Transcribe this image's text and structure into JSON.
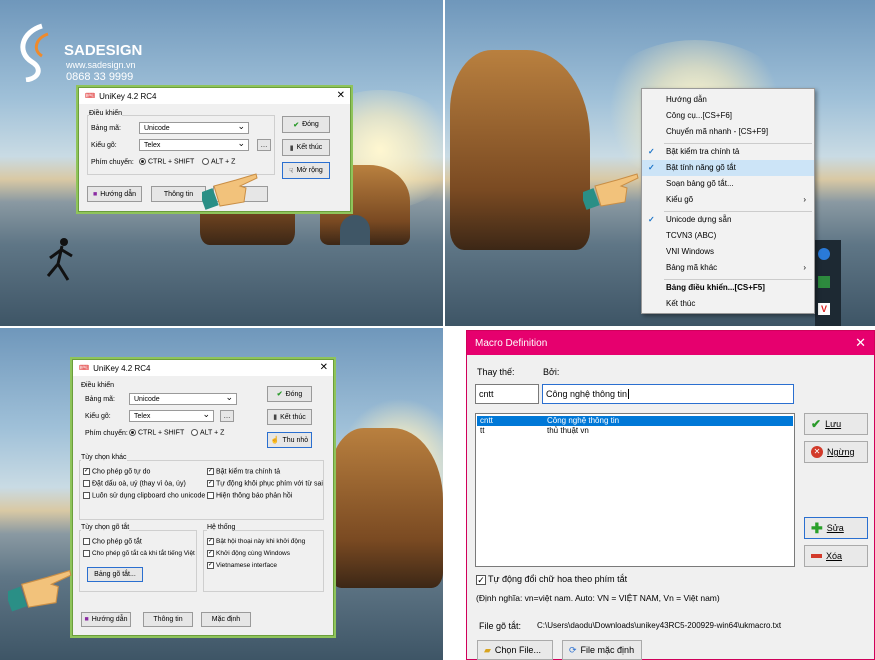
{
  "brand": {
    "name": "SADESIGN",
    "website": "www.sadesign.vn",
    "phone": "0868 33 9999"
  },
  "unikey": {
    "title": "UniKey 4.2 RC4",
    "group_controls": "Điều khiển",
    "charset_label": "Bảng mã:",
    "charset_value": "Unicode",
    "input_label": "Kiểu gõ:",
    "input_value": "Telex",
    "switch_label": "Phím chuyển:",
    "switch_opt1": "CTRL + SHIFT",
    "switch_opt2": "ALT + Z",
    "close_button": "Đóng",
    "exit_button": "Kết thúc",
    "expand_button": "Mở rộng",
    "collapse_button": "Thu nhỏ",
    "help_button": "Hướng dẫn",
    "info_button": "Thông tin",
    "default_button": "Mặc định"
  },
  "other_options": {
    "title": "Tùy chọn khác",
    "left": [
      {
        "label": "Cho phép gõ tự do",
        "checked": true
      },
      {
        "label": "Đặt dấu oà, uý (thay vì òa, úy)",
        "checked": false
      },
      {
        "label": "Luôn sử dụng clipboard cho unicode",
        "checked": false
      }
    ],
    "right": [
      {
        "label": "Bật kiểm tra chính tả",
        "checked": true
      },
      {
        "label": "Tự động khôi phục phím với từ sai",
        "checked": true
      },
      {
        "label": "Hiện thông báo phản hồi",
        "checked": false
      }
    ]
  },
  "macro_options": {
    "title": "Tùy chọn gõ tắt",
    "items": [
      {
        "label": "Cho phép gõ tắt",
        "checked": false
      },
      {
        "label": "Cho phép gõ tắt cả khi tắt tiếng Việt",
        "checked": false
      }
    ],
    "table_button": "Bảng gõ tắt..."
  },
  "system_options": {
    "title": "Hệ thống",
    "items": [
      {
        "label": "Bật hội thoại này khi khởi động",
        "checked": true
      },
      {
        "label": "Khởi động cùng Windows",
        "checked": true
      },
      {
        "label": "Vietnamese interface",
        "checked": true
      }
    ]
  },
  "tray_menu": {
    "items": [
      {
        "label": "Hướng dẫn",
        "checked": false
      },
      {
        "label": "Công cụ...[CS+F6]",
        "checked": false
      },
      {
        "label": "Chuyển mã nhanh - [CS+F9]",
        "checked": false
      },
      {
        "label": "Bật kiểm tra chính tả",
        "checked": true
      },
      {
        "label": "Bật tính năng gõ tắt",
        "checked": true,
        "highlighted": true
      },
      {
        "label": "Soạn bảng gõ tắt...",
        "checked": false
      },
      {
        "label": "Kiểu gõ",
        "checked": false,
        "submenu": true
      },
      {
        "label": "Unicode dựng sẵn",
        "checked": true
      },
      {
        "label": "TCVN3 (ABC)",
        "checked": false
      },
      {
        "label": "VNI Windows",
        "checked": false
      },
      {
        "label": "Bảng mã khác",
        "checked": false,
        "submenu": true
      },
      {
        "label": "Bảng điều khiển...[CS+F5]",
        "checked": false,
        "bold": true
      },
      {
        "label": "Kết thúc",
        "checked": false
      }
    ]
  },
  "macro_dialog": {
    "title": "Macro Definition",
    "replace_label": "Thay thế:",
    "by_label": "Bởi:",
    "replace_value": "cntt",
    "by_value": "Công nghệ thông tin",
    "rows": [
      {
        "key": "cntt",
        "value": "Công nghệ thông tin",
        "selected": true
      },
      {
        "key": "tt",
        "value": "thủ thuật vn",
        "selected": false
      }
    ],
    "save_button": "Lưu",
    "stop_button": "Ngừng",
    "edit_button": "Sửa",
    "delete_button": "Xóa",
    "auto_upper": "Tự động đổi chữ hoa theo phím tắt",
    "auto_upper_checked": true,
    "example": "(Định nghĩa: vn=việt nam. Auto: VN = VIỆT NAM, Vn = Việt nam)",
    "file_label": "File gõ tắt:",
    "file_path": "C:\\Users\\daodu\\Downloads\\unikey43RC5-200929-win64\\ukmacro.txt",
    "choose_file_button": "Chọn File...",
    "default_file_button": "File mặc định"
  },
  "colors": {
    "accent": "#e6006e",
    "highlight": "#cce4f7",
    "selected_row": "#0078d7",
    "window_border": "#8fc45b"
  }
}
